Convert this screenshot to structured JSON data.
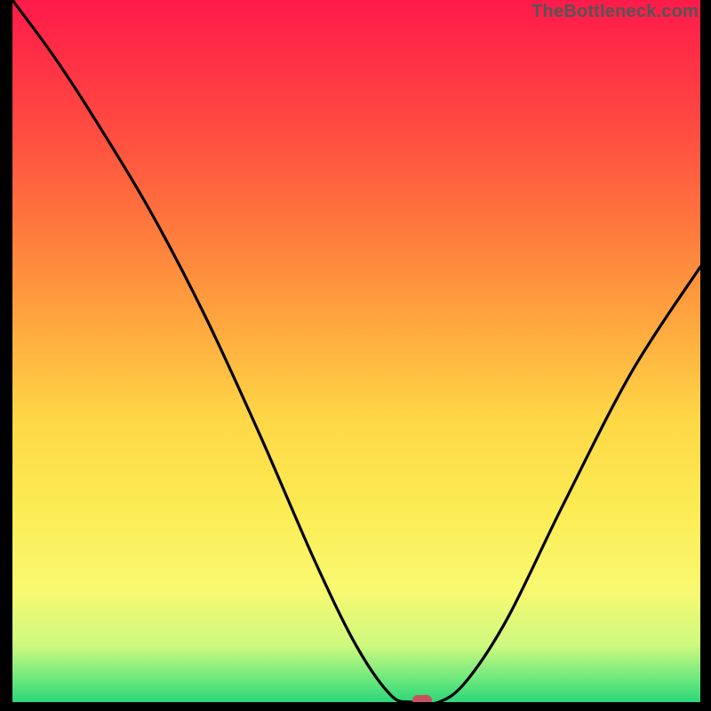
{
  "watermark": "TheBottleneck.com",
  "marker": {
    "x_percent": 59,
    "color": "#c95060"
  },
  "chart_data": {
    "type": "line",
    "title": "",
    "xlabel": "",
    "ylabel": "",
    "xlim": [
      0,
      100
    ],
    "ylim": [
      0,
      100
    ],
    "series": [
      {
        "name": "bottleneck-curve",
        "x": [
          0,
          6,
          12,
          20,
          28,
          36,
          44,
          50,
          55,
          58,
          62,
          66,
          72,
          80,
          90,
          100
        ],
        "y": [
          100,
          92,
          83,
          70,
          55,
          38,
          20,
          8,
          1,
          0,
          0,
          3,
          12,
          28,
          47,
          62
        ]
      }
    ],
    "background_gradient_stops": [
      {
        "pos": 0.0,
        "color": "#ff1a4a"
      },
      {
        "pos": 0.08,
        "color": "#ff2f46"
      },
      {
        "pos": 0.2,
        "color": "#ff5040"
      },
      {
        "pos": 0.34,
        "color": "#ff7e3d"
      },
      {
        "pos": 0.48,
        "color": "#ffae3f"
      },
      {
        "pos": 0.6,
        "color": "#ffd847"
      },
      {
        "pos": 0.72,
        "color": "#fceb52"
      },
      {
        "pos": 0.84,
        "color": "#f9f971"
      },
      {
        "pos": 0.92,
        "color": "#ccf97f"
      },
      {
        "pos": 0.97,
        "color": "#66e77d"
      },
      {
        "pos": 1.0,
        "color": "#2cd67a"
      }
    ]
  }
}
